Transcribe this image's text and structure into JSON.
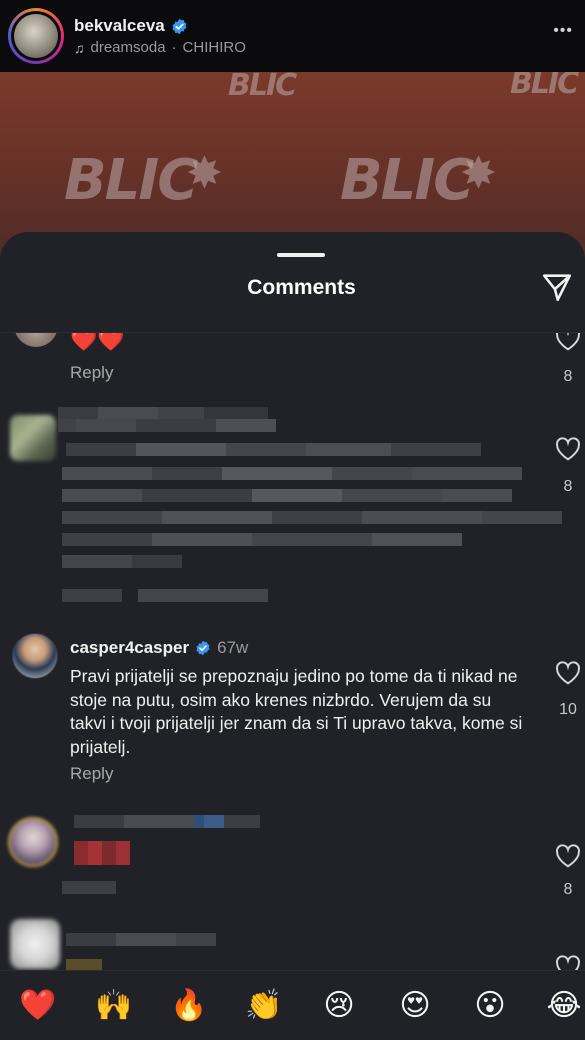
{
  "header": {
    "username": "bekvalceva",
    "audio_artist": "dreamsoda",
    "audio_separator": "·",
    "audio_title": "CHIHIRO",
    "more_label": "•••"
  },
  "video": {
    "watermark": "BLIC"
  },
  "sheet": {
    "title": "Comments"
  },
  "comments": [
    {
      "id": "c1",
      "reaction_text": "❤️❤️",
      "reply_label": "Reply",
      "likes": "8"
    },
    {
      "id": "c2",
      "blurred": true,
      "likes": "8"
    },
    {
      "id": "c3",
      "username": "casper4casper",
      "verified": true,
      "time": "67w",
      "text": "Pravi prijatelji se prepoznaju jedino po tome da ti nikad ne stoje na putu, osim ako krenes nizbrdo. Verujem da su takvi i tvoji prijatelji jer znam da si Ti upravo takva, kome si prijatelj.",
      "reply_label": "Reply",
      "likes": "10"
    },
    {
      "id": "c4",
      "blurred": true,
      "likes": "8"
    },
    {
      "id": "c5",
      "blurred": true
    }
  ],
  "reactions": [
    {
      "name": "red-heart",
      "glyph": "❤️"
    },
    {
      "name": "raised-hands",
      "glyph": "🙌"
    },
    {
      "name": "fire",
      "glyph": "🔥"
    },
    {
      "name": "clapping-hands",
      "glyph": "👏"
    },
    {
      "name": "crying-face",
      "glyph": "😢"
    },
    {
      "name": "heart-eyes",
      "glyph": "😍"
    },
    {
      "name": "surprised-face",
      "glyph": "😮"
    },
    {
      "name": "tears-of-joy",
      "glyph": "😂"
    }
  ],
  "colors": {
    "sheet_bg": "#212228",
    "verified_blue": "#3897f0",
    "like_heart_red": "#ff2d3a"
  }
}
